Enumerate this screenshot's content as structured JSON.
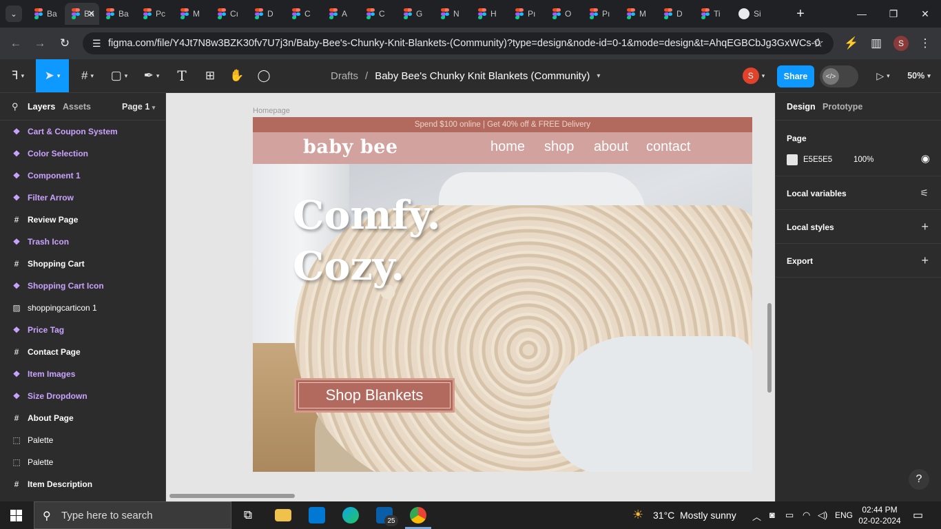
{
  "browser": {
    "tabs": [
      {
        "label": "Ba",
        "icon": "figma-icon"
      },
      {
        "label": "Ba",
        "icon": "figma-icon",
        "active": true
      },
      {
        "label": "Ba",
        "icon": "figma-icon"
      },
      {
        "label": "Pc",
        "icon": "figma-icon"
      },
      {
        "label": "M",
        "icon": "figma-icon"
      },
      {
        "label": "Cı",
        "icon": "figma-icon"
      },
      {
        "label": "D",
        "icon": "figma-icon"
      },
      {
        "label": "C",
        "icon": "figma-icon"
      },
      {
        "label": "A",
        "icon": "figma-icon"
      },
      {
        "label": "C",
        "icon": "figma-icon"
      },
      {
        "label": "G",
        "icon": "figma-icon"
      },
      {
        "label": "N",
        "icon": "figma-icon"
      },
      {
        "label": "H",
        "icon": "figma-icon"
      },
      {
        "label": "Pı",
        "icon": "figma-icon"
      },
      {
        "label": "O",
        "icon": "figma-icon"
      },
      {
        "label": "Pı",
        "icon": "figma-icon"
      },
      {
        "label": "M",
        "icon": "figma-icon"
      },
      {
        "label": "D",
        "icon": "figma-icon"
      },
      {
        "label": "Ti",
        "icon": "figma-icon"
      },
      {
        "label": "Si",
        "icon": "github-icon"
      }
    ],
    "url": "figma.com/file/Y4Jt7N8w3BZK30fv7U7j3n/Baby-Bee's-Chunky-Knit-Blankets-(Community)?type=design&node-id=0-1&mode=design&t=AhqEGBCbJg3GxWCs-0",
    "profile_initial": "S"
  },
  "toolbar": {
    "breadcrumb_root": "Drafts",
    "separator": "/",
    "file_name": "Baby Bee's Chunky Knit Blankets (Community)",
    "user_initial": "S",
    "share_label": "Share",
    "zoom": "50%"
  },
  "left_panel": {
    "tab_layers": "Layers",
    "tab_assets": "Assets",
    "page_selector": "Page 1",
    "layers": [
      {
        "name": "Cart & Coupon System",
        "kind": "component"
      },
      {
        "name": "Color Selection",
        "kind": "component"
      },
      {
        "name": "Component 1",
        "kind": "component"
      },
      {
        "name": "Filter Arrow",
        "kind": "component"
      },
      {
        "name": "Review Page",
        "kind": "frame"
      },
      {
        "name": "Trash Icon",
        "kind": "component"
      },
      {
        "name": "Shopping Cart",
        "kind": "frame"
      },
      {
        "name": "Shopping Cart Icon",
        "kind": "component"
      },
      {
        "name": "shoppingcarticon 1",
        "kind": "image"
      },
      {
        "name": "Price Tag",
        "kind": "component"
      },
      {
        "name": "Contact Page",
        "kind": "frame"
      },
      {
        "name": "Item Images",
        "kind": "component"
      },
      {
        "name": "Size Dropdown",
        "kind": "component"
      },
      {
        "name": "About Page",
        "kind": "frame"
      },
      {
        "name": "Palette",
        "kind": "section"
      },
      {
        "name": "Palette",
        "kind": "section"
      },
      {
        "name": "Item Description",
        "kind": "frame"
      }
    ]
  },
  "canvas": {
    "frame_label": "Homepage",
    "promo": "Spend $100 online | Get 40% off & FREE Delivery",
    "logo": "baby bee",
    "nav": [
      "home",
      "shop",
      "about",
      "contact"
    ],
    "headline_1": "Comfy.",
    "headline_2": "Cozy.",
    "cta": "Shop Blankets"
  },
  "right_panel": {
    "tab_design": "Design",
    "tab_prototype": "Prototype",
    "page_heading": "Page",
    "page_color": "E5E5E5",
    "page_opacity": "100%",
    "local_variables": "Local variables",
    "local_styles": "Local styles",
    "export": "Export"
  },
  "taskbar": {
    "search_placeholder": "Type here to search",
    "mail_badge": "25",
    "weather_temp": "31°C",
    "weather_desc": "Mostly sunny",
    "language": "ENG",
    "time": "02:44 PM",
    "date": "02-02-2024"
  },
  "colors": {
    "figma_blue": "#0d99ff",
    "promo_bg": "#b36a5e",
    "nav_bg": "#d2a29f",
    "canvas_bg": "#e5e5e5"
  }
}
